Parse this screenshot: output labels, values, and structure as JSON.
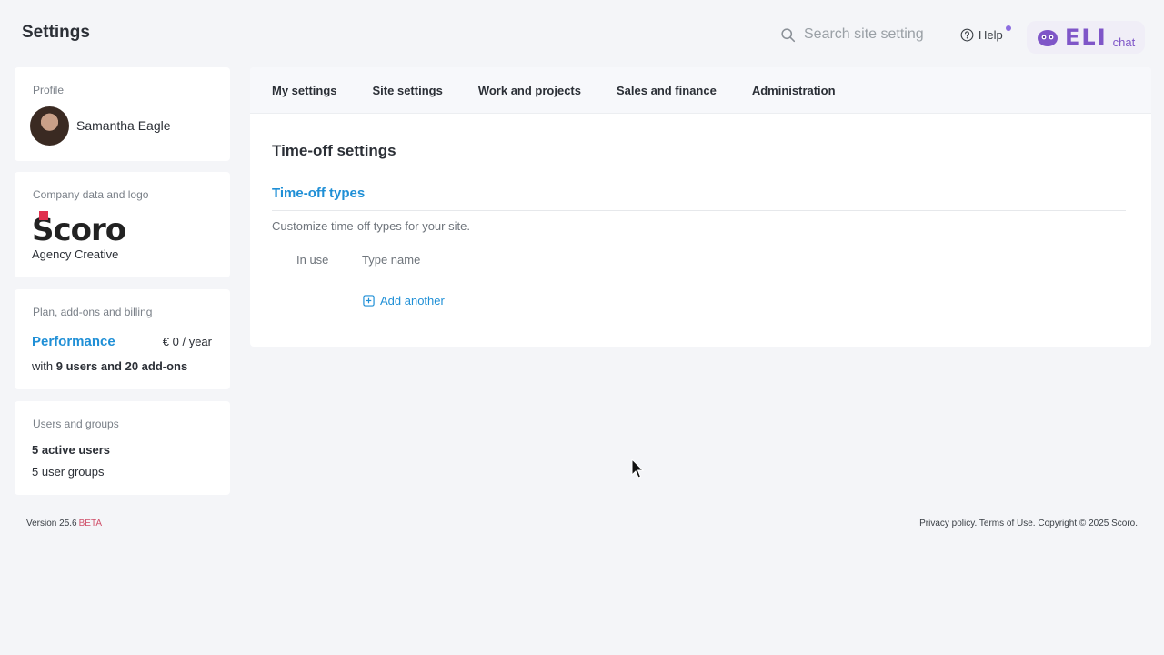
{
  "header": {
    "title": "Settings",
    "search_placeholder": "Search site setting",
    "help_label": "Help",
    "eli_logo": "ELI",
    "eli_chat": "chat"
  },
  "sidebar": {
    "profile": {
      "label": "Profile",
      "name": "Samantha Eagle"
    },
    "company": {
      "label": "Company data and logo",
      "logo_text": "Scoro",
      "name": "Agency Creative"
    },
    "plan": {
      "label": "Plan, add-ons and billing",
      "name": "Performance",
      "price": "€ 0 / year",
      "detail_prefix": "with ",
      "detail_bold": "9 users and 20 add-ons"
    },
    "users": {
      "label": "Users and groups",
      "active": "5 active users",
      "groups": "5 user groups"
    }
  },
  "main": {
    "tabs": [
      {
        "label": "My settings"
      },
      {
        "label": "Site settings"
      },
      {
        "label": "Work and projects"
      },
      {
        "label": "Sales and finance"
      },
      {
        "label": "Administration"
      }
    ],
    "section_title": "Time-off settings",
    "subsection_title": "Time-off types",
    "description": "Customize time-off types for your site.",
    "table_headers": [
      "In use",
      "Type name"
    ],
    "add_label": "Add another"
  },
  "footer": {
    "version": "Version 25.6",
    "beta": "BETA",
    "legal": "Privacy policy. Terms of Use. Copyright © 2025 Scoro."
  },
  "colors": {
    "accent": "#1f8fd6",
    "eli": "#7f56c8",
    "beta": "#d0506a",
    "brand_mark": "#e0304e"
  }
}
